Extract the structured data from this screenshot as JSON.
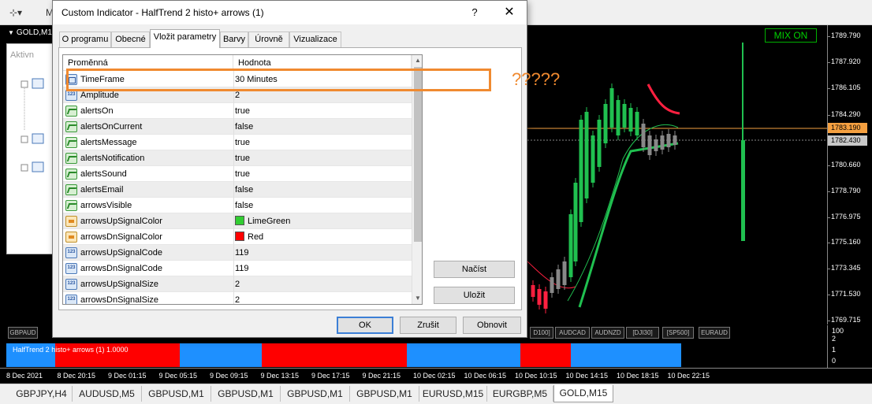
{
  "toolbar": {
    "left_icon": "⊹▾",
    "left_label": "M"
  },
  "chart": {
    "title": "GOLD,M1",
    "mix_badge": "MIX ON",
    "price_labels": [
      "1789.790",
      "1787.920",
      "1786.105",
      "1784.290",
      "1780.660",
      "1778.790",
      "1776.975",
      "1775.160",
      "1773.345",
      "1771.530",
      "1769.715"
    ],
    "current_price_tag": "1783.190",
    "bid_price_tag": "1782.430",
    "symbol_tabs": [
      "GBPAUD",
      "D100]",
      "AUDCAD",
      "AUDNZD",
      "[DJI30]",
      "[SP500]",
      "EURAUD"
    ],
    "indicator_label": "HalfTrend 2 histo+ arrows (1) 1.0000",
    "indicator_scale": [
      "2",
      "1",
      "0"
    ],
    "indicator_scale_top": "100",
    "time_labels": [
      "8 Dec 2021",
      "8 Dec 20:15",
      "9 Dec 01:15",
      "9 Dec 05:15",
      "9 Dec 09:15",
      "9 Dec 13:15",
      "9 Dec 17:15",
      "9 Dec 21:15",
      "10 Dec 02:15",
      "10 Dec 06:15",
      "10 Dec 10:15",
      "10 Dec 14:15",
      "10 Dec 18:15",
      "10 Dec 22:15"
    ]
  },
  "navigator": {
    "header": "Aktivn"
  },
  "bottom_tabs": [
    "GBPJPY,H4",
    "AUDUSD,M5",
    "GBPUSD,M1",
    "GBPUSD,M1",
    "GBPUSD,M1",
    "GBPUSD,M1",
    "EURUSD,M15",
    "EURGBP,M5",
    "GOLD,M15"
  ],
  "dialog": {
    "title": "Custom Indicator - HalfTrend 2 histo+ arrows (1)",
    "help": "?",
    "close": "✕",
    "tabs": [
      "O programu",
      "Obecné",
      "Vložit parametry",
      "Barvy",
      "Úrovně",
      "Vizualizace"
    ],
    "active_tab": "Vložit parametry",
    "columns": {
      "name": "Proměnná",
      "value": "Hodnota"
    },
    "params": [
      {
        "name": "TimeFrame",
        "value": "30 Minutes",
        "type": "timeframe"
      },
      {
        "name": "Amplitude",
        "value": "2",
        "type": "int"
      },
      {
        "name": "alertsOn",
        "value": "true",
        "type": "bool"
      },
      {
        "name": "alertsOnCurrent",
        "value": "false",
        "type": "bool"
      },
      {
        "name": "alertsMessage",
        "value": "true",
        "type": "bool"
      },
      {
        "name": "alertsNotification",
        "value": "true",
        "type": "bool"
      },
      {
        "name": "alertsSound",
        "value": "true",
        "type": "bool"
      },
      {
        "name": "alertsEmail",
        "value": "false",
        "type": "bool"
      },
      {
        "name": "arrowsVisible",
        "value": "false",
        "type": "bool"
      },
      {
        "name": "arrowsUpSignalColor",
        "value": "LimeGreen",
        "type": "color",
        "color": "#32cd32"
      },
      {
        "name": "arrowsDnSignalColor",
        "value": "Red",
        "type": "color",
        "color": "#ff0000"
      },
      {
        "name": "arrowsUpSignalCode",
        "value": "119",
        "type": "int"
      },
      {
        "name": "arrowsDnSignalCode",
        "value": "119",
        "type": "int"
      },
      {
        "name": "arrowsUpSignalSize",
        "value": "2",
        "type": "int"
      },
      {
        "name": "arrowsDnSignalSize",
        "value": "2",
        "type": "int"
      }
    ],
    "buttons": {
      "load": "Načíst",
      "save": "Uložit",
      "ok": "OK",
      "cancel": "Zrušit",
      "reset": "Obnovit"
    }
  },
  "annotation": {
    "text": "?????",
    "color": "#f08a30"
  }
}
